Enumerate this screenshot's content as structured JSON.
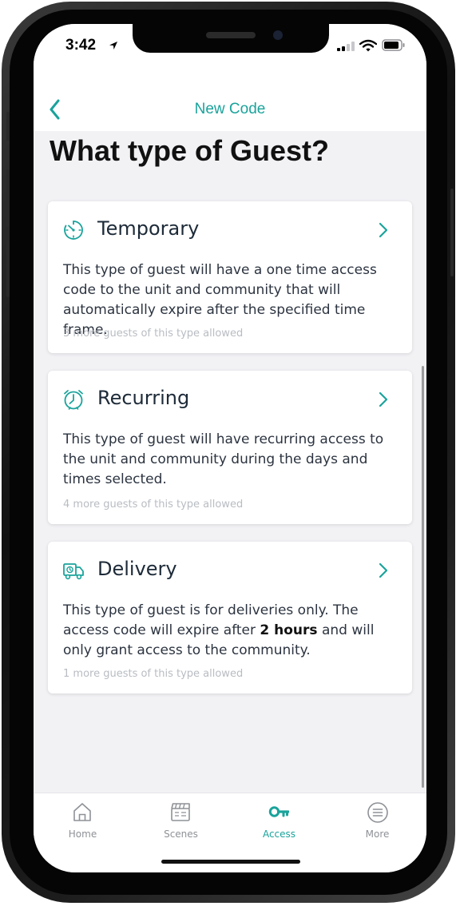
{
  "status_bar": {
    "time": "3:42"
  },
  "nav": {
    "title": "New Code"
  },
  "page": {
    "heading": "What type of Guest?"
  },
  "guest_types": [
    {
      "title": "Temporary",
      "icon": "timer-icon",
      "description": "This type of guest will have a one time access code to the unit and community that will automatically expire after the specified time frame.",
      "note": "3 more guests of this type allowed"
    },
    {
      "title": "Recurring",
      "icon": "alarm-clock-icon",
      "description": "This type of guest will have recurring access to the unit and community during the days and times selected.",
      "note": "4 more guests of this type allowed"
    },
    {
      "title": "Delivery",
      "icon": "delivery-truck-icon",
      "description_before": "This type of guest is for deliveries only. The access code will expire after ",
      "description_bold": "2 hours",
      "description_after": " and will only grant access to the community.",
      "note": "1 more guests of this type allowed"
    }
  ],
  "tab_bar": {
    "active": "Access",
    "tabs": [
      {
        "label": "Home",
        "icon": "home-icon"
      },
      {
        "label": "Scenes",
        "icon": "clapperboard-icon"
      },
      {
        "label": "Access",
        "icon": "key-icon"
      },
      {
        "label": "More",
        "icon": "menu-circle-icon"
      }
    ]
  },
  "colors": {
    "accent": "#1aa39b",
    "inactive": "#8e9196",
    "text": "#1d2a38",
    "background": "#f2f2f5"
  }
}
